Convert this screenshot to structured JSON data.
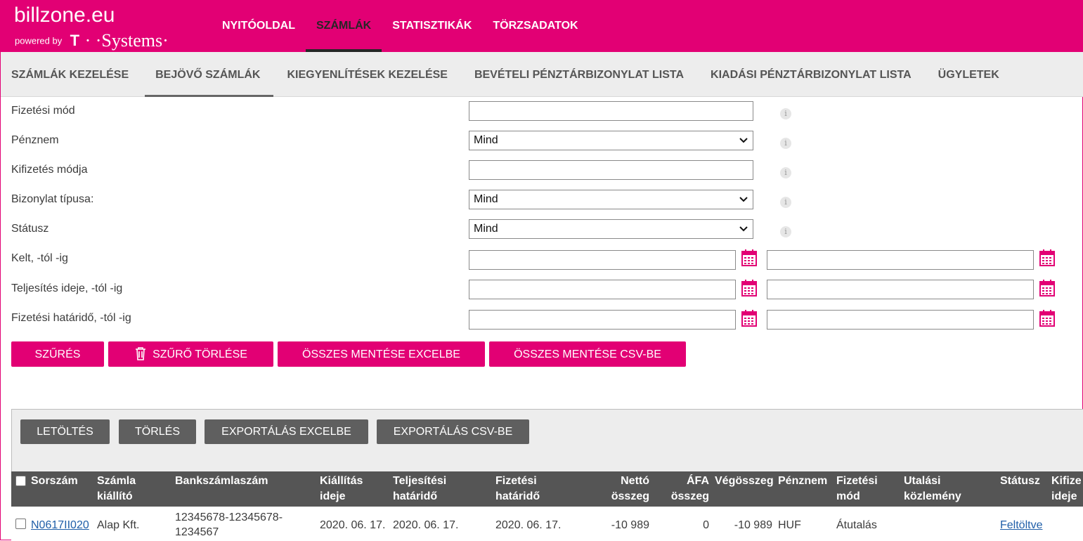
{
  "header": {
    "logo_main": "billzone.eu",
    "logo_powered": "powered by",
    "logo_t": "T",
    "logo_systems": "· ·Systems·",
    "nav": [
      "NYITÓOLDAL",
      "SZÁMLÁK",
      "STATISZTIKÁK",
      "TÖRZSADATOK"
    ],
    "active_nav": "SZÁMLÁK"
  },
  "subnav": {
    "items": [
      "SZÁMLÁK KEZELÉSE",
      "BEJÖVŐ SZÁMLÁK",
      "KIEGYENLÍTÉSEK KEZELÉSE",
      "BEVÉTELI PÉNZTÁRBIZONYLAT LISTA",
      "KIADÁSI PÉNZTÁRBIZONYLAT LISTA",
      "ÜGYLETEK"
    ],
    "active": "BEJÖVŐ SZÁMLÁK"
  },
  "filters": {
    "fizetesi_mod": {
      "label": "Fizetési mód",
      "value": ""
    },
    "penznem": {
      "label": "Pénznem",
      "value": "Mind"
    },
    "kifizetes_modja": {
      "label": "Kifizetés módja",
      "value": ""
    },
    "bizonylat_tipusa": {
      "label": "Bizonylat típusa:",
      "value": "Mind"
    },
    "statusz": {
      "label": "Státusz",
      "value": "Mind"
    },
    "kelt": {
      "label": "Kelt, -tól -ig",
      "from": "",
      "to": ""
    },
    "teljesites": {
      "label": "Teljesítés ideje, -tól -ig",
      "from": "",
      "to": ""
    },
    "hatarido": {
      "label": "Fizetési határidő, -tól -ig",
      "from": "",
      "to": ""
    },
    "info_glyph": "i"
  },
  "filter_buttons": {
    "filter": "SZŰRÉS",
    "clear": "SZŰRŐ TÖRLÉSE",
    "save_excel": "ÖSSZES MENTÉSE EXCELBE",
    "save_csv": "ÖSSZES MENTÉSE CSV-BE"
  },
  "table_buttons": {
    "download": "LETÖLTÉS",
    "delete": "TÖRLÉS",
    "export_excel": "EXPORTÁLÁS EXCELBE",
    "export_csv": "EXPORTÁLÁS CSV-BE"
  },
  "table": {
    "columns": {
      "sorszam": "Sorszám",
      "kiallito_1": "Számla",
      "kiallito_2": "kiállító",
      "bankszamla": "Bankszámlaszám",
      "kiallitas_1": "Kiállítás",
      "kiallitas_2": "ideje",
      "teljesitesi_1": "Teljesítési",
      "teljesitesi_2": "határidő",
      "fizetesi_1": "Fizetési",
      "fizetesi_2": "határidő",
      "netto_1": "Nettó",
      "netto_2": "összeg",
      "afa_1": "ÁFA",
      "afa_2": "összeg",
      "vegosszeg": "Végösszeg",
      "penznem": "Pénznem",
      "fizmod_1": "Fizetési",
      "fizmod_2": "mód",
      "utalasi_1": "Utalási",
      "utalasi_2": "közlemény",
      "statusz": "Státusz",
      "kifiz_1": "Kifize",
      "kifiz_2": "ideje"
    },
    "rows": [
      {
        "sorszam": "N0617II020",
        "kiallito": "Alap Kft.",
        "bank_1": "12345678-12345678-",
        "bank_2": "1234567",
        "kiallitas": "2020. 06. 17.",
        "teljesitesi": "2020. 06. 17.",
        "fizetesi": "2020. 06. 17.",
        "netto": "-10 989",
        "afa": "0",
        "vegosszeg": "-10 989",
        "penznem": "HUF",
        "fizmod": "Átutalás",
        "utalasi": "",
        "statusz": "Feltöltve"
      }
    ]
  },
  "colors": {
    "brand": "#e20074",
    "dark": "#555555",
    "button_grey": "#5f5f5f"
  }
}
